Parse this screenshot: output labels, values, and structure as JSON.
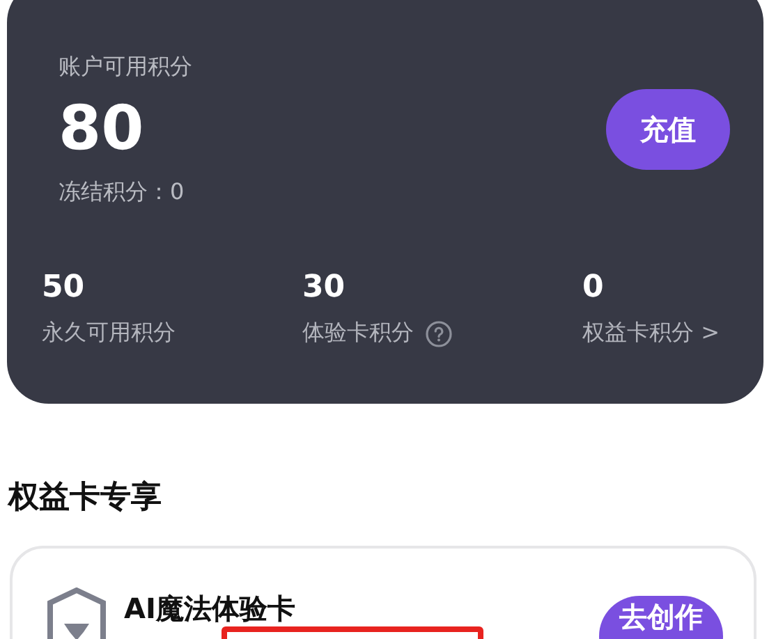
{
  "balance": {
    "label": "账户可用积分",
    "value": "80",
    "frozen": "冻结积分：0",
    "recharge_button": "充值"
  },
  "stats": [
    {
      "kind": "plain",
      "value": "50",
      "label": "永久可用积分"
    },
    {
      "kind": "help",
      "value": "30",
      "label": "体验卡积分"
    },
    {
      "kind": "link",
      "value": "0",
      "label": "权益卡积分 >"
    }
  ],
  "section_title": "权益卡专享",
  "cards": [
    {
      "title": "AI魔法体验卡",
      "button": "去创作",
      "highlighted": true
    }
  ]
}
